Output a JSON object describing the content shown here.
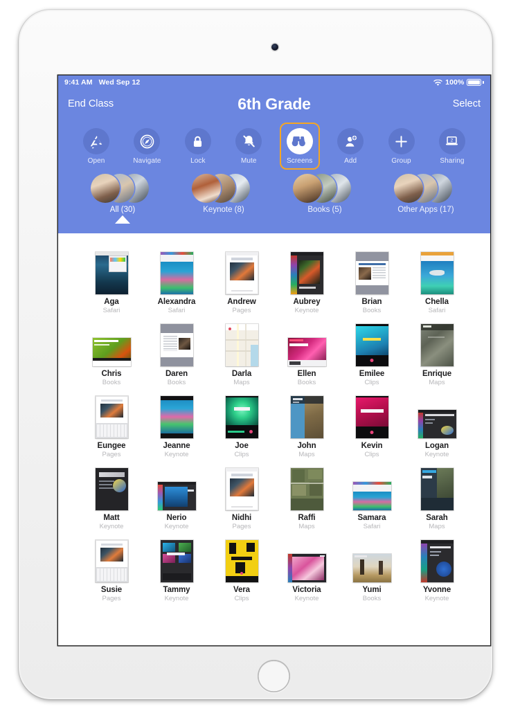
{
  "device": {
    "name": "iPad",
    "camera": "front-camera",
    "home_button": "home-button"
  },
  "status_bar": {
    "time": "9:41 AM",
    "date": "Wed Sep 12",
    "wifi": "wifi-icon",
    "battery_percent": "100%"
  },
  "nav": {
    "left_button": "End Class",
    "title": "6th Grade",
    "right_button": "Select"
  },
  "toolbar": {
    "items": [
      {
        "label": "Open",
        "icon": "app-store-icon",
        "selected": false
      },
      {
        "label": "Navigate",
        "icon": "safari-compass-icon",
        "selected": false
      },
      {
        "label": "Lock",
        "icon": "lock-icon",
        "selected": false
      },
      {
        "label": "Mute",
        "icon": "bell-slash-icon",
        "selected": false
      },
      {
        "label": "Screens",
        "icon": "binoculars-icon",
        "selected": true
      },
      {
        "label": "Add",
        "icon": "person-add-icon",
        "selected": false
      },
      {
        "label": "Group",
        "icon": "plus-icon",
        "selected": false
      },
      {
        "label": "Sharing",
        "icon": "laptop-icon",
        "selected": false,
        "badge": "2"
      }
    ]
  },
  "group_tabs": {
    "items": [
      {
        "label": "All (30)",
        "count": 30,
        "active": true
      },
      {
        "label": "Keynote (8)",
        "count": 8,
        "active": false
      },
      {
        "label": "Books (5)",
        "count": 5,
        "active": false
      },
      {
        "label": "Other Apps (17)",
        "count": 17,
        "active": false
      }
    ]
  },
  "students": [
    {
      "name": "Aga",
      "app": "Safari",
      "art": "reef-browser",
      "orient": "portrait"
    },
    {
      "name": "Alexandra",
      "app": "Safari",
      "art": "coral-browser",
      "orient": "portrait"
    },
    {
      "name": "Andrew",
      "app": "Pages",
      "art": "doc-clownfish",
      "orient": "portrait"
    },
    {
      "name": "Aubrey",
      "app": "Keynote",
      "art": "dark-slide",
      "orient": "portrait"
    },
    {
      "name": "Brian",
      "app": "Books",
      "art": "book-page",
      "orient": "portrait"
    },
    {
      "name": "Chella",
      "app": "Safari",
      "art": "shark-browser",
      "orient": "portrait"
    },
    {
      "name": "Chris",
      "app": "Books",
      "art": "green-cover",
      "orient": "landscape"
    },
    {
      "name": "Daren",
      "app": "Books",
      "art": "book-page2",
      "orient": "portrait"
    },
    {
      "name": "Darla",
      "app": "Maps",
      "art": "street-map",
      "orient": "portrait"
    },
    {
      "name": "Ellen",
      "app": "Books",
      "art": "magenta-cover",
      "orient": "landscape"
    },
    {
      "name": "Emilee",
      "app": "Clips",
      "art": "cyan-clip",
      "orient": "portrait"
    },
    {
      "name": "Enrique",
      "app": "Maps",
      "art": "satellite-map",
      "orient": "portrait"
    },
    {
      "name": "Eungee",
      "app": "Pages",
      "art": "doc-keyboard",
      "orient": "portrait"
    },
    {
      "name": "Jeanne",
      "app": "Keynote",
      "art": "coral-slide",
      "orient": "portrait"
    },
    {
      "name": "Joe",
      "app": "Clips",
      "art": "green-clip",
      "orient": "portrait"
    },
    {
      "name": "John",
      "app": "Maps",
      "art": "coast-map",
      "orient": "portrait"
    },
    {
      "name": "Kevin",
      "app": "Clips",
      "art": "pink-clip",
      "orient": "portrait"
    },
    {
      "name": "Logan",
      "app": "Keynote",
      "art": "fish-slide",
      "orient": "landscape"
    },
    {
      "name": "Matt",
      "app": "Keynote",
      "art": "fish-slide2",
      "orient": "portrait"
    },
    {
      "name": "Nerio",
      "app": "Keynote",
      "art": "blue-slide",
      "orient": "landscape"
    },
    {
      "name": "Nidhi",
      "app": "Pages",
      "art": "doc-clownfish",
      "orient": "portrait"
    },
    {
      "name": "Raffi",
      "app": "Maps",
      "art": "farm-map",
      "orient": "portrait"
    },
    {
      "name": "Samara",
      "app": "Safari",
      "art": "coral-browser",
      "orient": "landscape"
    },
    {
      "name": "Sarah",
      "app": "Maps",
      "art": "coast-map2",
      "orient": "portrait"
    },
    {
      "name": "Susie",
      "app": "Pages",
      "art": "doc-keyboard",
      "orient": "portrait"
    },
    {
      "name": "Tammy",
      "app": "Keynote",
      "art": "grid-slide",
      "orient": "portrait"
    },
    {
      "name": "Vera",
      "app": "Clips",
      "art": "yellow-clip",
      "orient": "portrait"
    },
    {
      "name": "Victoria",
      "app": "Keynote",
      "art": "pink-flower",
      "orient": "landscape"
    },
    {
      "name": "Yumi",
      "app": "Books",
      "art": "desert-photo",
      "orient": "landscape"
    },
    {
      "name": "Yvonne",
      "app": "Keynote",
      "art": "dark-slide2",
      "orient": "portrait"
    }
  ],
  "colors": {
    "header_blue": "#6b86e0",
    "tool_circle": "#5e77cd",
    "selection_orange": "#f5a623",
    "name_text": "#1d1d1f",
    "app_text": "#b6b6b9"
  }
}
